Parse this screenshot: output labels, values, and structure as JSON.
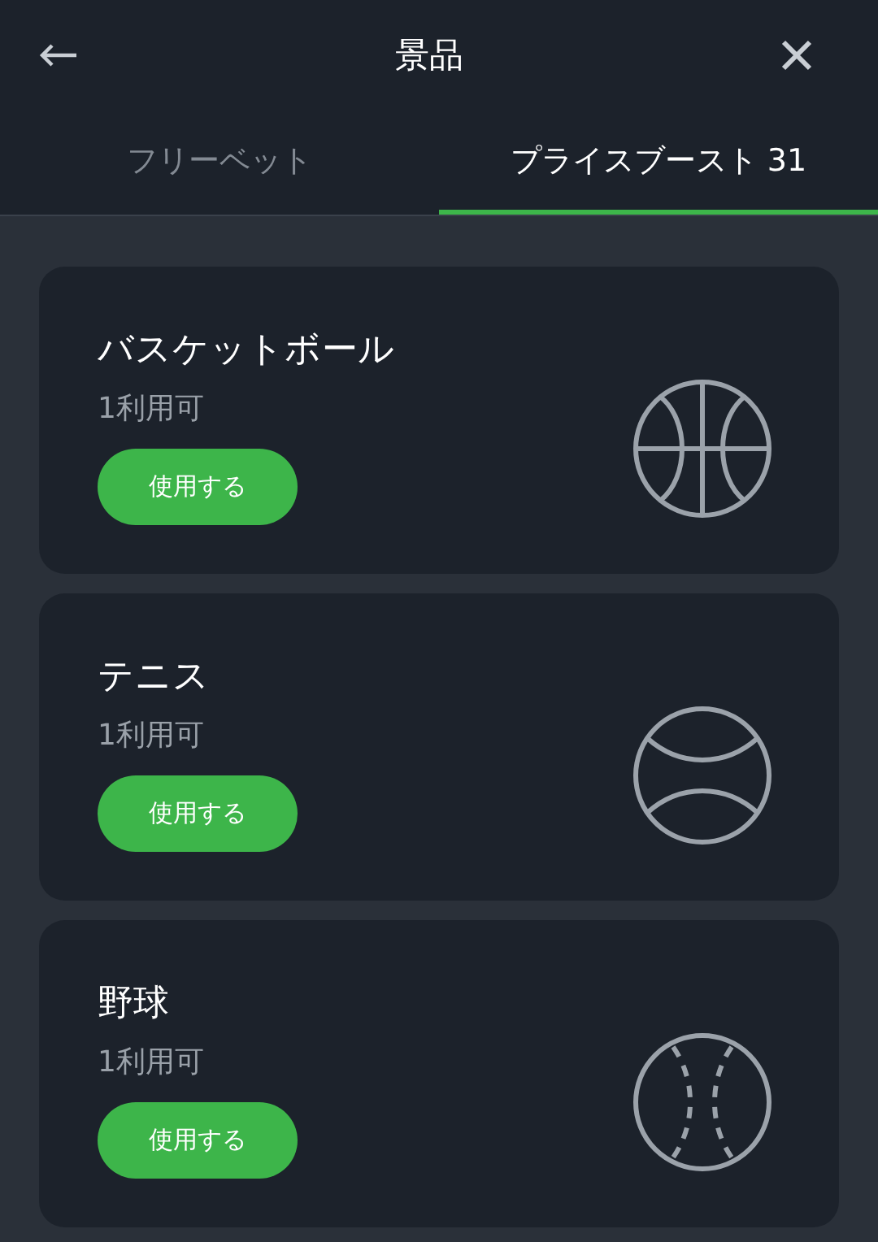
{
  "header": {
    "title": "景品"
  },
  "tabs": [
    {
      "label": "フリーベット",
      "selected": false
    },
    {
      "label": "プライスブースト 31",
      "selected": true
    }
  ],
  "cards": [
    {
      "kind": "basketball",
      "title": "バスケットボール",
      "availability": "1利用可",
      "button": "使用する"
    },
    {
      "kind": "tennis",
      "title": "テニス",
      "availability": "1利用可",
      "button": "使用する"
    },
    {
      "kind": "baseball",
      "title": "野球",
      "availability": "1利用可",
      "button": "使用する"
    }
  ]
}
